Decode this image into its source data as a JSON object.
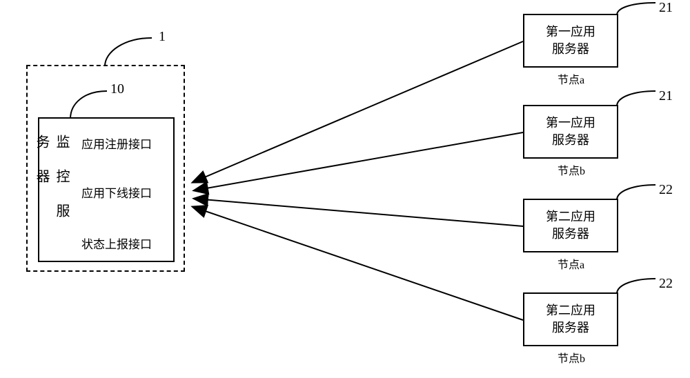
{
  "monitor": {
    "container_label_num": "1",
    "inner_label_num": "10",
    "title": "监\n控\n服\n务\n器",
    "interfaces": {
      "register": "应用注册接口",
      "offline": "应用下线接口",
      "report": "状态上报接口"
    }
  },
  "servers": [
    {
      "label_num": "21",
      "title_line1": "第一应用",
      "title_line2": "服务器",
      "node": "节点a"
    },
    {
      "label_num": "21",
      "title_line1": "第一应用",
      "title_line2": "服务器",
      "node": "节点b"
    },
    {
      "label_num": "22",
      "title_line1": "第二应用",
      "title_line2": "服务器",
      "node": "节点a"
    },
    {
      "label_num": "22",
      "title_line1": "第二应用",
      "title_line2": "服务器",
      "node": "节点b"
    }
  ]
}
